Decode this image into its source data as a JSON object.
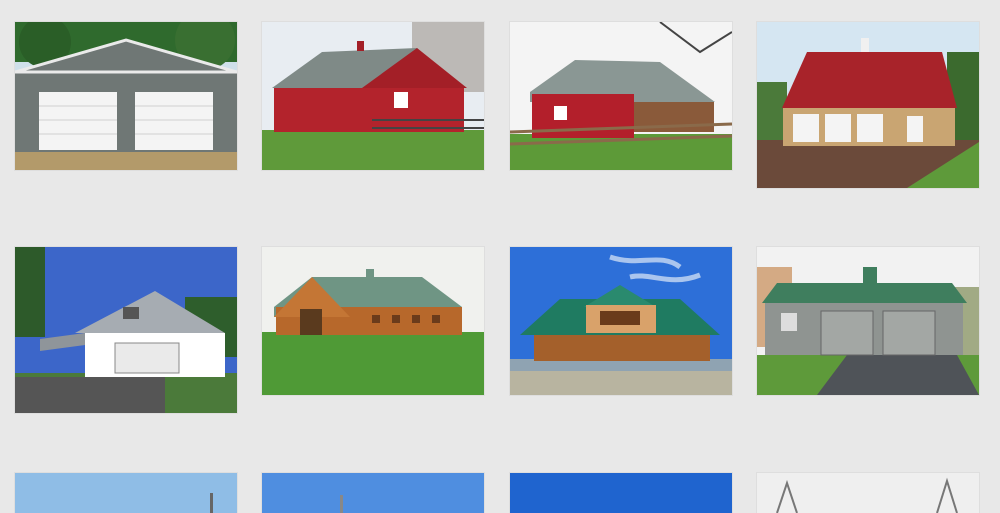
{
  "gallery": {
    "items": [
      {
        "subject": "gray-steel-two-car-garage",
        "sky": "#cfe0ea",
        "body": "#6f7775",
        "roof": "#8c9593"
      },
      {
        "subject": "red-barn-with-fence",
        "sky": "#e8edf2",
        "body": "#b3232c",
        "roof": "#7f8a87"
      },
      {
        "subject": "red-barn-with-wood-fence",
        "sky": "#f4f4f4",
        "body": "#b31f2b",
        "roof": "#8a9794"
      },
      {
        "subject": "tan-three-car-garage-red-roof",
        "sky": "#d5e6f2",
        "body": "#c9a572",
        "roof": "#a8232a"
      },
      {
        "subject": "white-garage-with-carport",
        "sky": "#3c66c9",
        "body": "#ffffff",
        "roof": "#a6acb2"
      },
      {
        "subject": "wood-horse-barn-green-roof",
        "sky": "#f0f1ee",
        "body": "#b7682b",
        "roof": "#6f9584"
      },
      {
        "subject": "wood-barn-with-loft-green-roof",
        "sky": "#2d6fd8",
        "body": "#a4602b",
        "roof": "#1f7b61"
      },
      {
        "subject": "gray-two-car-garage-green-roof",
        "sky": "#f2f2f2",
        "body": "#8f9491",
        "roof": "#3f7e5e"
      },
      {
        "subject": "partial-sky-light-blue",
        "sky": "#8fbde6"
      },
      {
        "subject": "partial-sky-blue",
        "sky": "#4f8ee0"
      },
      {
        "subject": "partial-sky-deep-blue",
        "sky": "#1f64cf"
      },
      {
        "subject": "partial-sky-overcast",
        "sky": "#efefef"
      }
    ]
  }
}
